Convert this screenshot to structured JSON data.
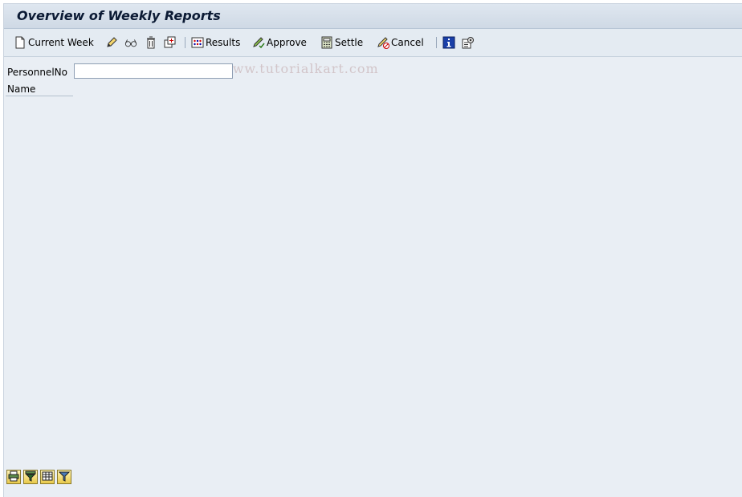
{
  "window": {
    "title": "Overview of Weekly Reports"
  },
  "toolbar": {
    "current_week_label": "Current Week",
    "results_label": "Results",
    "approve_label": "Approve",
    "settle_label": "Settle",
    "cancel_label": "Cancel",
    "icons": [
      "new-document-icon",
      "pencil-icon",
      "glasses-icon",
      "trash-icon",
      "copy-icon",
      "results-icon",
      "approve-icon",
      "calculator-icon",
      "cancel-icon",
      "info-icon",
      "settings-icon"
    ]
  },
  "watermark": "www.tutorialkart.com",
  "form": {
    "personnel_label": "PersonnelNo",
    "personnel_value": "",
    "name_label": "Name"
  },
  "bottom_toolbar": {
    "icons": [
      "print-icon",
      "filter-icon",
      "layout-icon",
      "funnel-icon"
    ]
  },
  "colors": {
    "background": "#e9eef4",
    "title_text": "#0b1a34",
    "bottom_button": "#e8c94a"
  }
}
